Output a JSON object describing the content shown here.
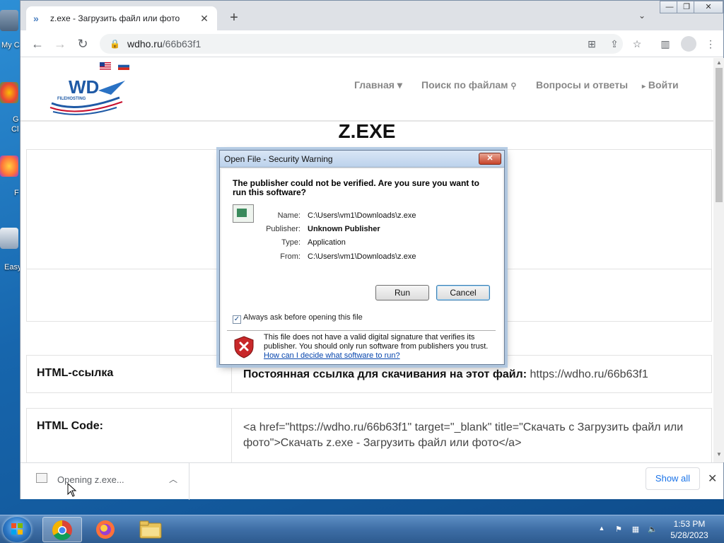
{
  "desktop": {
    "labels": [
      "My C",
      "G",
      "Cl",
      "F",
      "Easy"
    ]
  },
  "browser": {
    "tab_title": "z.exe - Загрузить файл или фото",
    "tab_close": "✕",
    "new_tab": "+",
    "tab_list": "⌄",
    "url_host": "wdho.ru",
    "url_path": "/66b63f1",
    "window_controls": [
      "—",
      "❐",
      "✕"
    ]
  },
  "site": {
    "flags": [
      "en-flag",
      "ru-flag"
    ],
    "logo_text": "WD",
    "logo_subtext": "FILEHOSTING",
    "nav": {
      "home": "Главная ▾",
      "search": "Поиск по файлам",
      "faq": "Вопросы и ответы",
      "login": "Войти"
    },
    "page_title": "Z.EXE",
    "rows": [
      {
        "label": "HTML-ссылка",
        "value_bold": "Постоянная ссылка для скачивания на этот файл:",
        "value_rest": " https://wdho.ru/66b63f1"
      },
      {
        "label": "HTML Code:",
        "value": "<a href=\"https://wdho.ru/66b63f1\" target=\"_blank\" title=\"Скачать с Загрузить файл или фото\">Скачать z.exe - Загрузить файл или фото</a>"
      }
    ]
  },
  "download_bar": {
    "item_text": "Opening z.exe...",
    "show_all": "Show all",
    "close": "✕"
  },
  "dialog": {
    "title": "Open File - Security Warning",
    "close": "✕",
    "heading": "The publisher could not be verified.  Are you sure you want to run this software?",
    "fields": [
      {
        "key": "Name:",
        "value": "C:\\Users\\vm1\\Downloads\\z.exe"
      },
      {
        "key": "Publisher:",
        "value": "Unknown Publisher"
      },
      {
        "key": "Type:",
        "value": "Application"
      },
      {
        "key": "From:",
        "value": "C:\\Users\\vm1\\Downloads\\z.exe"
      }
    ],
    "run_label": "Run",
    "cancel_label": "Cancel",
    "checkbox_label": "Always ask before opening this file",
    "checkbox_checked": true,
    "warning_text": "This file does not have a valid digital signature that verifies its publisher.  You should only run software from publishers you trust.",
    "warning_link": "How can I decide what software to run?"
  },
  "taskbar": {
    "apps": [
      "chrome-icon",
      "firefox-icon",
      "explorer-icon"
    ],
    "time": "1:53 PM",
    "date": "5/28/2023",
    "tray_arrow": "▲"
  }
}
